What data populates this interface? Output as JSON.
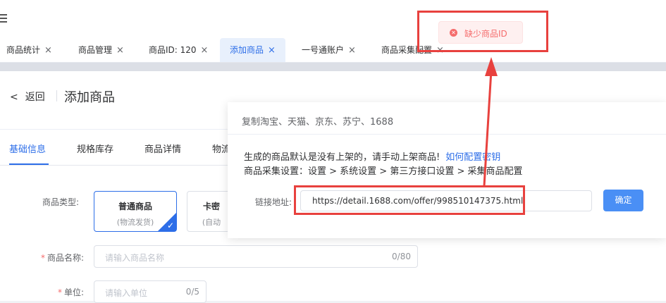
{
  "tabs": [
    {
      "label": "商品统计",
      "close": "×"
    },
    {
      "label": "商品管理",
      "close": "×"
    },
    {
      "label": "商品ID: 120",
      "close": "×"
    },
    {
      "label": "添加商品",
      "close": "×"
    },
    {
      "label": "一号通账户",
      "close": "×"
    },
    {
      "label": "商品采集配置",
      "close": "×"
    }
  ],
  "header": {
    "back_label": "返回",
    "title": "添加商品"
  },
  "subtabs": [
    "基础信息",
    "规格库存",
    "商品详情",
    "物流"
  ],
  "form": {
    "type_label": "商品类型:",
    "type_cards": [
      {
        "title": "普通商品",
        "subtitle": "(物流发货)"
      },
      {
        "title": "卡密",
        "subtitle": "(自动"
      }
    ],
    "name_label": "商品名称:",
    "name_placeholder": "请输入商品名称",
    "name_count": "0/80",
    "unit_label": "单位:",
    "unit_placeholder": "请输入单位",
    "unit_count": "0/5"
  },
  "import_panel": {
    "heading": "复制淘宝、天猫、京东、苏宁、1688",
    "notice": "生成的商品默认是没有上架的，请手动上架商品!",
    "config_link": "如何配置密钥",
    "path": "商品采集设置：设置 > 系统设置 > 第三方接口设置 > 采集商品配置",
    "link_label": "链接地址:",
    "link_value": "https://detail.1688.com/offer/998510147375.html",
    "confirm_label": "确定"
  },
  "toast": {
    "icon": "error-icon",
    "message": "缺少商品ID"
  },
  "colors": {
    "accent": "#2d6ee8",
    "error": "#f56c6c",
    "annotation": "#e8413e"
  }
}
